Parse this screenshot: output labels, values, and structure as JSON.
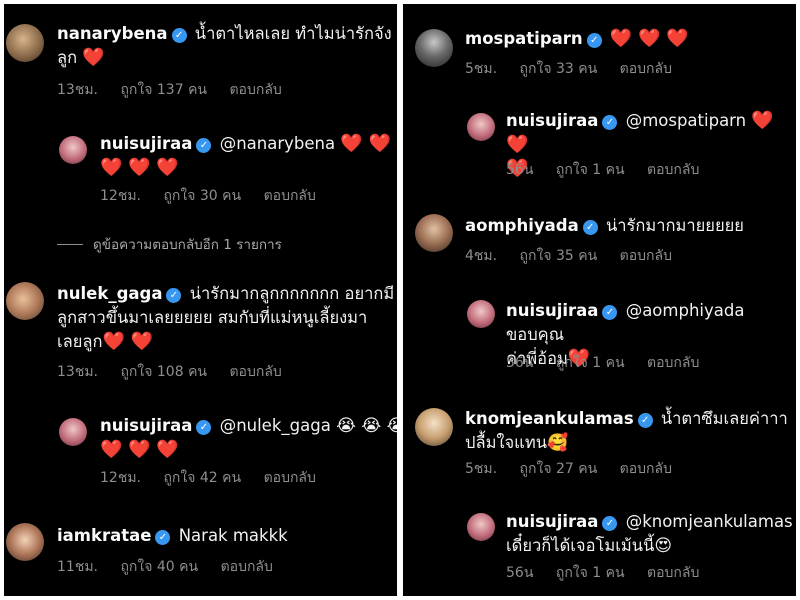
{
  "left": {
    "comments": [
      {
        "username": "nanarybena",
        "text": "น้ำตาไหลเลย ทำไมน่ารักจัง",
        "text2": "ลูก",
        "hearts": "❤️",
        "time": "13ชม.",
        "likes": "ถูกใจ 137 คน",
        "reply": "ตอบกลับ"
      },
      {
        "username": "nuisujiraa",
        "mention": "@nanarybena",
        "hearts1": "❤️ ❤️",
        "hearts2": "❤️ ❤️ ❤️",
        "time": "12ชม.",
        "likes": "ถูกใจ 30 คน",
        "reply": "ตอบกลับ"
      },
      {
        "view_replies": "ดูข้อความตอบกลับอีก 1 รายการ"
      },
      {
        "username": "nulek_gaga",
        "text": "น่ารักมากลูกกกกกกก อยากมี",
        "text2": "ลูกสาวขึ้นมาเลยยยยย สมกับที่แม่หนูเลี้ยงมา",
        "text3": "เลยลูก",
        "hearts": "❤️ ❤️",
        "time": "13ชม.",
        "likes": "ถูกใจ 108 คน",
        "reply": "ตอบกลับ"
      },
      {
        "username": "nuisujiraa",
        "mention": "@nulek_gaga",
        "emojis": "😭 😭 😭",
        "hearts2": "❤️ ❤️ ❤️",
        "time": "12ชม.",
        "likes": "ถูกใจ 42 คน",
        "reply": "ตอบกลับ"
      },
      {
        "username": "iamkratae",
        "text": "Narak makkk",
        "time": "11ชม.",
        "likes": "ถูกใจ 40 คน",
        "reply": "ตอบกลับ"
      }
    ]
  },
  "right": {
    "comments": [
      {
        "username": "mospatiparn",
        "hearts": "❤️ ❤️ ❤️",
        "time": "5ชม.",
        "likes": "ถูกใจ 33 คน",
        "reply": "ตอบกลับ"
      },
      {
        "username": "nuisujiraa",
        "mention": "@mospatiparn",
        "hearts1": "❤️ ❤️",
        "hearts2": "❤️",
        "time": "56น",
        "likes": "ถูกใจ 1 คน",
        "reply": "ตอบกลับ"
      },
      {
        "username": "aomphiyada",
        "text": "น่ารักมากมายยยยย",
        "time": "4ชม.",
        "likes": "ถูกใจ 35 คน",
        "reply": "ตอบกลับ"
      },
      {
        "username": "nuisujiraa",
        "mention": "@aomphiyada",
        "text": "ขอบคุณ",
        "text2": "ค่าพี่อ้อม",
        "hearts": "❤️",
        "time": "56น",
        "likes": "ถูกใจ 1 คน",
        "reply": "ตอบกลับ"
      },
      {
        "username": "knomjeankulamas",
        "text": "น้ำตาซึมเลยค่าาา",
        "text2": "ปลื้มใจแทน",
        "emoji": "🥰",
        "time": "5ชม.",
        "likes": "ถูกใจ 27 คน",
        "reply": "ตอบกลับ"
      },
      {
        "username": "nuisujiraa",
        "mention": "@knomjeankulamas",
        "text2": "เดี๋ยวก็ได้เจอโมเม้นนี้",
        "emoji": "😍",
        "time": "56น",
        "likes": "ถูกใจ 1 คน",
        "reply": "ตอบกลับ"
      }
    ]
  },
  "colors": {
    "background": "#000000",
    "text": "#f2f2f2",
    "meta": "#8e8e8e",
    "verified": "#3897f0",
    "heart": "#ed2b3a"
  },
  "icons": {
    "verified": "verified-badge-icon"
  }
}
